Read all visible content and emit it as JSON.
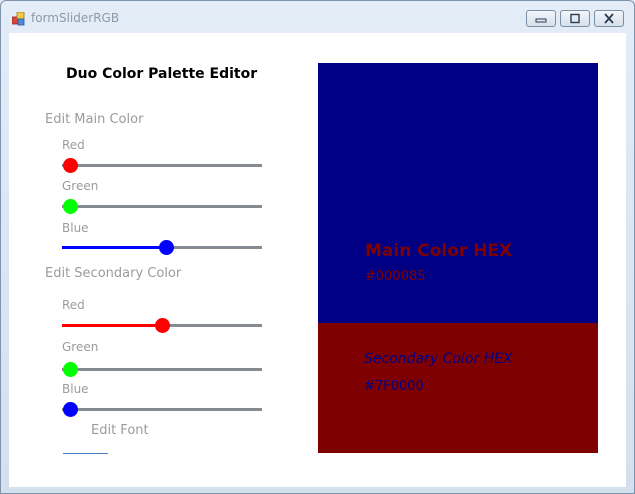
{
  "window": {
    "title": "formSliderRGB",
    "minimize_label": "minimize",
    "maximize_label": "maximize",
    "close_label": "close"
  },
  "editor": {
    "heading": "Duo Color Palette Editor",
    "main_group": {
      "label": "Edit Main Color",
      "channels": [
        {
          "label": "Red",
          "value": 0,
          "max": 255,
          "color": "#ff0000"
        },
        {
          "label": "Green",
          "value": 0,
          "max": 255,
          "color": "#00ff00"
        },
        {
          "label": "Blue",
          "value": 133,
          "max": 255,
          "color": "#0000ff"
        }
      ]
    },
    "secondary_group": {
      "label": "Edit Secondary Color",
      "channels": [
        {
          "label": "Red",
          "value": 127,
          "max": 255,
          "color": "#ff0000"
        },
        {
          "label": "Green",
          "value": 0,
          "max": 255,
          "color": "#00ff00"
        },
        {
          "label": "Blue",
          "value": 0,
          "max": 255,
          "color": "#0000ff"
        }
      ]
    },
    "font_button_label": "Edit Font"
  },
  "preview": {
    "main_color": "#000085",
    "secondary_color": "#7f0000",
    "main_title": "Main Color HEX",
    "main_hex": "#000085",
    "secondary_title": "Secondary Color HEX",
    "secondary_hex": "#7F0000"
  }
}
